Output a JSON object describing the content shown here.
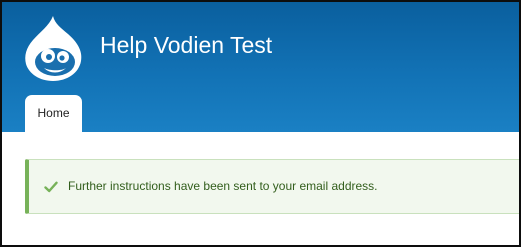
{
  "site": {
    "name": "Help Vodien Test",
    "logo_icon": "drupal-drop-icon"
  },
  "tabs": [
    {
      "label": "Home",
      "active": true
    }
  ],
  "message": {
    "type": "status",
    "icon": "check-icon",
    "text": "Further instructions have been sent to your email address."
  },
  "colors": {
    "header": "#1272b5",
    "message_bg": "#f2f8ee",
    "message_accent": "#77b259",
    "message_text": "#325e1c"
  }
}
